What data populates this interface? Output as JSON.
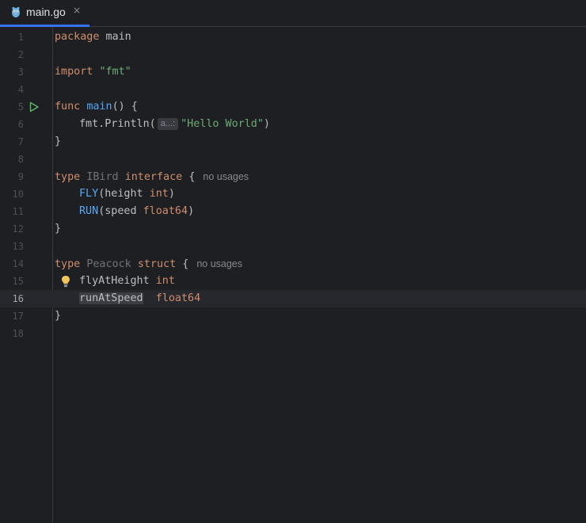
{
  "tab": {
    "filename": "main.go",
    "close_glyph": "×"
  },
  "icons": {
    "file": "gopher-icon",
    "close": "close-icon",
    "run": "run-icon",
    "intention": "lightbulb-icon"
  },
  "colors": {
    "background": "#1e1f22",
    "keyword": "#cf8e6d",
    "function": "#56a8f5",
    "string": "#6aab73",
    "accent": "#3574f0",
    "run_green": "#5fb865",
    "bulb_yellow": "#f2c55c"
  },
  "line_numbers": [
    "1",
    "2",
    "3",
    "4",
    "5",
    "6",
    "7",
    "8",
    "9",
    "10",
    "11",
    "12",
    "13",
    "14",
    "15",
    "16",
    "17",
    "18"
  ],
  "current_line": "16",
  "code": {
    "l1": {
      "kw": "package",
      "name": "main"
    },
    "l3": {
      "kw": "import",
      "str": "\"fmt\""
    },
    "l5": {
      "kw": "func",
      "name": "main",
      "rest": "() {"
    },
    "l6": {
      "call": "fmt.Println(",
      "hint": "a...:",
      "str": "\"Hello World\"",
      "close": ")"
    },
    "l7": {
      "text": "}"
    },
    "l9": {
      "kw": "type",
      "name": "IBird",
      "kw2": "interface",
      "brace": "{",
      "usages": "no usages"
    },
    "l10": {
      "method": "FLY",
      "open": "(height ",
      "type": "int",
      "close": ")"
    },
    "l11": {
      "method": "RUN",
      "open": "(speed ",
      "type": "float64",
      "close": ")"
    },
    "l12": {
      "text": "}"
    },
    "l14": {
      "kw": "type",
      "name": "Peacock",
      "kw2": "struct",
      "brace": "{",
      "usages": "no usages"
    },
    "l15": {
      "field": "flyAtHeight",
      "type": "int"
    },
    "l16": {
      "field": "runAtSpeed",
      "type": "float64"
    },
    "l17": {
      "text": "}"
    }
  }
}
